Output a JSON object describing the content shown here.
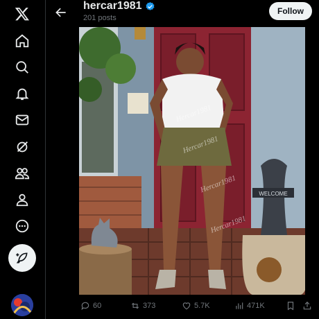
{
  "app": {
    "logo": "x-logo-icon"
  },
  "nav": {
    "items": [
      {
        "name": "home",
        "icon": "home-icon"
      },
      {
        "name": "explore",
        "icon": "search-icon"
      },
      {
        "name": "notifications",
        "icon": "bell-icon"
      },
      {
        "name": "messages",
        "icon": "mail-icon"
      },
      {
        "name": "grok",
        "icon": "grok-icon"
      },
      {
        "name": "communities",
        "icon": "people-icon"
      },
      {
        "name": "profile",
        "icon": "person-icon"
      },
      {
        "name": "more",
        "icon": "more-circle-icon"
      }
    ],
    "post_icon": "feather-plus-icon"
  },
  "header": {
    "username": "hercar1981",
    "posts_count": "201 posts",
    "follow_label": "Follow",
    "verified_color": "#1d9bf0"
  },
  "photo": {
    "watermark": "Hercar1981",
    "sign_text": "WELCOME"
  },
  "actions": {
    "replies": "60",
    "reposts": "373",
    "likes": "5.7K",
    "views": "471K"
  },
  "colors": {
    "background": "#000000",
    "text": "#e7e9ea",
    "muted": "#71767b",
    "accent": "#1d9bf0",
    "button_bg": "#eff3f4"
  }
}
